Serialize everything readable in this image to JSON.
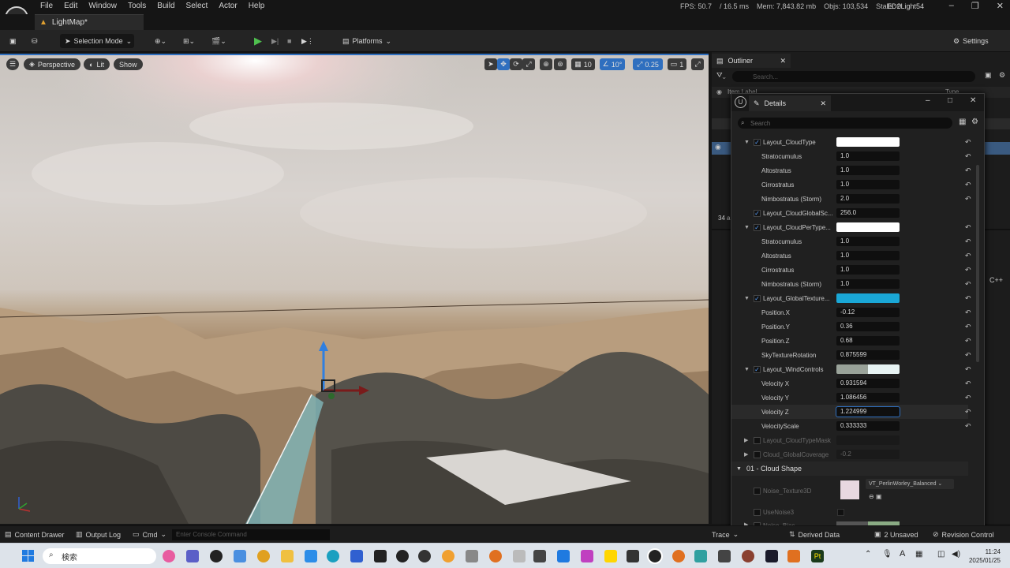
{
  "menu": {
    "items": [
      "File",
      "Edit",
      "Window",
      "Tools",
      "Build",
      "Select",
      "Actor",
      "Help"
    ]
  },
  "stats": {
    "fps": "FPS: 50.7",
    "ms": "/ 16.5 ms",
    "mem": "Mem: 7,843.82 mb",
    "objs": "Objs: 103,534",
    "stalls": "Stalls: 0"
  },
  "project_name": "ED2Light54",
  "level_tab": "LightMap*",
  "toolbar": {
    "selection_mode": "Selection Mode",
    "platforms": "Platforms",
    "settings": "Settings"
  },
  "viewport": {
    "perspective": "Perspective",
    "lit": "Lit",
    "show": "Show",
    "grid_snap": "10",
    "rot_snap": "10°",
    "scale_snap": "0.25",
    "camera_speed": "1"
  },
  "outliner": {
    "tab": "Outliner",
    "search_placeholder": "Search...",
    "col_label": "Item Label",
    "col_type": "Type",
    "count": "34 a",
    "side_text": "C++"
  },
  "details": {
    "tab": "Details",
    "search_placeholder": "Search",
    "rows": [
      {
        "name": "Layout_CloudType",
        "value": "",
        "kind": "color-white",
        "checked": true,
        "expand": true
      },
      {
        "name": "Stratocumulus",
        "value": "1.0",
        "kind": "num"
      },
      {
        "name": "Altostratus",
        "value": "1.0",
        "kind": "num"
      },
      {
        "name": "Cirrostratus",
        "value": "1.0",
        "kind": "num"
      },
      {
        "name": "Nimbostratus (Storm)",
        "value": "2.0",
        "kind": "num"
      },
      {
        "name": "Layout_CloudGlobalSc...",
        "value": "256.0",
        "kind": "num",
        "checked": true
      },
      {
        "name": "Layout_CloudPerType...",
        "value": "",
        "kind": "color-white",
        "checked": true,
        "expand": true
      },
      {
        "name": "Stratocumulus",
        "value": "1.0",
        "kind": "num"
      },
      {
        "name": "Altostratus",
        "value": "1.0",
        "kind": "num"
      },
      {
        "name": "Cirrostratus",
        "value": "1.0",
        "kind": "num"
      },
      {
        "name": "Nimbostratus (Storm)",
        "value": "1.0",
        "kind": "num"
      },
      {
        "name": "Layout_GlobalTexture...",
        "value": "",
        "kind": "color-cyan",
        "checked": true,
        "expand": true
      },
      {
        "name": "Position.X",
        "value": "-0.12",
        "kind": "num"
      },
      {
        "name": "Position.Y",
        "value": "0.36",
        "kind": "num"
      },
      {
        "name": "Position.Z",
        "value": "0.68",
        "kind": "num"
      },
      {
        "name": "SkyTextureRotation",
        "value": "0.875599",
        "kind": "num"
      },
      {
        "name": "Layout_WindControls",
        "value": "",
        "kind": "color-check",
        "checked": true,
        "expand": true
      },
      {
        "name": "Velocity X",
        "value": "0.931594",
        "kind": "num"
      },
      {
        "name": "Velocity Y",
        "value": "1.086456",
        "kind": "num"
      },
      {
        "name": "Velocity Z",
        "value": "1.224999",
        "kind": "num",
        "active": true
      },
      {
        "name": "VelocityScale",
        "value": "0.333333",
        "kind": "num"
      },
      {
        "name": "Layout_CloudTypeMask",
        "value": "",
        "kind": "dim"
      },
      {
        "name": "Cloud_GlobalCoverage",
        "value": "-0.2",
        "kind": "dim"
      }
    ],
    "section": "01 - Cloud Shape",
    "noise_texture_label": "Noise_Texture3D",
    "noise_texture_asset": "VT_PerlinWorley_Balanced",
    "use_noise_label": "UseNoise3",
    "noise_bias_label": "Noise_Bias"
  },
  "statusbar": {
    "content_drawer": "Content Drawer",
    "output_log": "Output Log",
    "cmd": "Cmd",
    "console_placeholder": "Enter Console Command",
    "trace": "Trace",
    "derived_data": "Derived Data",
    "unsaved": "2 Unsaved",
    "revision": "Revision Control"
  },
  "taskbar": {
    "search": "検索",
    "time": "11:24",
    "date": "2025/01/25"
  },
  "colors": {
    "accent": "#2f6fbf",
    "cyan_swatch": "#1aa7d6",
    "play_green": "#4fc14f"
  }
}
